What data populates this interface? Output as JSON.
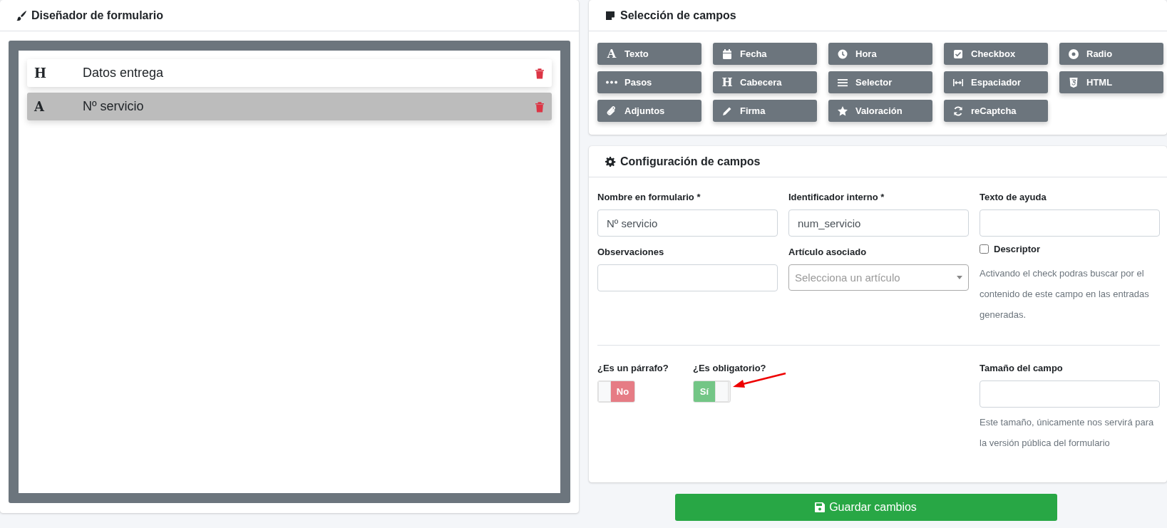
{
  "designer": {
    "title": "Diseñador de formulario",
    "items": [
      {
        "glyph": "H",
        "label": "Datos entrega",
        "selected": false
      },
      {
        "glyph": "A",
        "label": "Nº servicio",
        "selected": true
      }
    ]
  },
  "field_selection": {
    "title": "Selección de campos",
    "buttons": [
      {
        "kind": "text",
        "glyph": "A",
        "label": "Texto"
      },
      {
        "kind": "date",
        "label": "Fecha"
      },
      {
        "kind": "time",
        "label": "Hora"
      },
      {
        "kind": "checkbox",
        "label": "Checkbox"
      },
      {
        "kind": "radio",
        "label": "Radio"
      },
      {
        "kind": "steps",
        "label": "Pasos"
      },
      {
        "kind": "heading",
        "glyph": "H",
        "label": "Cabecera"
      },
      {
        "kind": "select",
        "label": "Selector"
      },
      {
        "kind": "spacer",
        "label": "Espaciador"
      },
      {
        "kind": "html",
        "label": "HTML"
      },
      {
        "kind": "attachment",
        "label": "Adjuntos"
      },
      {
        "kind": "signature",
        "label": "Firma"
      },
      {
        "kind": "rating",
        "label": "Valoración"
      },
      {
        "kind": "captcha",
        "label": "reCaptcha"
      }
    ]
  },
  "field_config": {
    "title": "Configuración de campos",
    "fields": [
      {
        "kind": "input",
        "label": "Nombre en formulario *",
        "value": "Nº servicio"
      },
      {
        "kind": "input",
        "label": "Identificador interno *",
        "value": "num_servicio"
      },
      {
        "kind": "input",
        "label": "Texto de ayuda"
      },
      {
        "kind": "input",
        "label": "Observaciones"
      },
      {
        "kind": "select",
        "label": "Artículo asociado",
        "placeholder": "Selecciona un artículo"
      },
      {
        "kind": "checkbox",
        "label": "Descriptor",
        "checked": false,
        "help": "Activando el check podras buscar por el contenido de este campo en las entradas generadas."
      }
    ],
    "toggles": [
      {
        "label": "¿Es un párrafo?",
        "on": false,
        "text": "No"
      },
      {
        "label": "¿Es obligatorio?",
        "on": true,
        "text": "Sí"
      }
    ],
    "size": {
      "label": "Tamaño del campo",
      "help": "Este tamaño, únicamente nos servirá para la versión pública del formulario"
    }
  },
  "save_button": "Guardar cambios"
}
